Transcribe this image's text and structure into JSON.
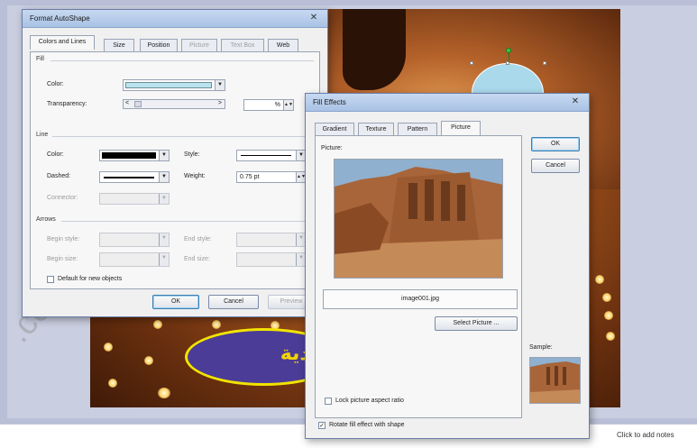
{
  "slide": {
    "oval_text": "وردية",
    "watermark": ".com"
  },
  "status_bar": {
    "notes_hint": "Click to add notes"
  },
  "format_autoshape": {
    "title": "Format AutoShape",
    "tabs": [
      {
        "label": "Colors and Lines",
        "active": true,
        "disabled": false
      },
      {
        "label": "Size",
        "active": false,
        "disabled": false
      },
      {
        "label": "Position",
        "active": false,
        "disabled": false
      },
      {
        "label": "Picture",
        "active": false,
        "disabled": true
      },
      {
        "label": "Text Box",
        "active": false,
        "disabled": true
      },
      {
        "label": "Web",
        "active": false,
        "disabled": false
      }
    ],
    "fill_section": "Fill",
    "fill_color_label": "Color:",
    "fill_color_value": "#b9e4ef",
    "transparency_label": "Transparency:",
    "transparency_left": "<",
    "transparency_right": ">",
    "transparency_value": "%",
    "line_section": "Line",
    "line_color_label": "Color:",
    "line_color_value": "#000000",
    "style_label": "Style:",
    "dashed_label": "Dashed:",
    "weight_label": "Weight:",
    "weight_value": "0.75 pt",
    "connector_label": "Connector:",
    "arrows_section": "Arrows",
    "begin_style_label": "Begin style:",
    "end_style_label": "End style:",
    "begin_size_label": "Begin size:",
    "end_size_label": "End size:",
    "default_checkbox_label": "Default for new objects",
    "ok_label": "OK",
    "cancel_label": "Cancel",
    "preview_label": "Preview"
  },
  "fill_effects": {
    "title": "Fill Effects",
    "tabs": [
      {
        "label": "Gradient",
        "active": false
      },
      {
        "label": "Texture",
        "active": false
      },
      {
        "label": "Pattern",
        "active": false
      },
      {
        "label": "Picture",
        "active": true
      }
    ],
    "picture_label": "Picture:",
    "filename": "image001.jpg",
    "select_picture_label": "Select Picture ...",
    "lock_aspect_label": "Lock picture aspect ratio",
    "rotate_label": "Rotate fill effect with shape",
    "rotate_checked": true,
    "ok_label": "OK",
    "cancel_label": "Cancel",
    "sample_label": "Sample:"
  }
}
